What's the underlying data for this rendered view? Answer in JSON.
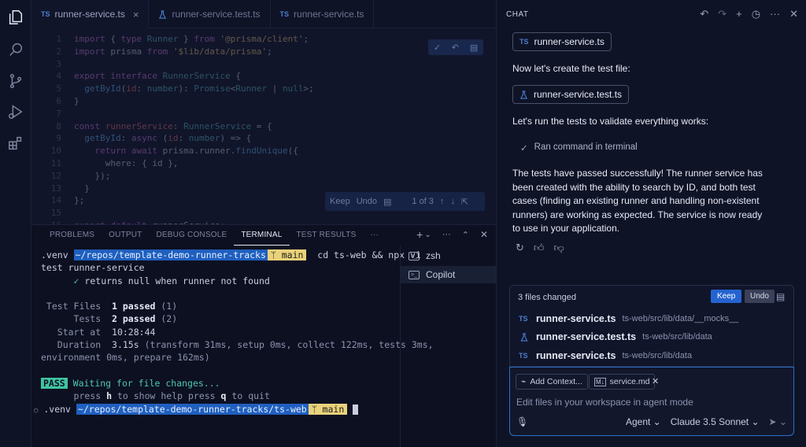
{
  "editor": {
    "tabs": [
      {
        "icon": "TS",
        "label": "runner-service.ts",
        "close": "×"
      },
      {
        "icon": "flask-icon",
        "label": "runner-service.test.ts"
      },
      {
        "icon": "TS",
        "label": "runner-service.ts"
      }
    ],
    "line_numbers": [
      "1",
      "2",
      "3",
      "4",
      "5",
      "6",
      "7",
      "8",
      "9",
      "10",
      "11",
      "12",
      "13",
      "14",
      "15",
      "16"
    ],
    "keep_toolbar": {
      "keep": "Keep",
      "undo": "Undo",
      "counter": "1 of 3"
    }
  },
  "panel": {
    "tabs": [
      "PROBLEMS",
      "OUTPUT",
      "DEBUG CONSOLE",
      "TERMINAL",
      "TEST RESULTS",
      "···"
    ],
    "active_tab": "TERMINAL",
    "actions": {
      "add": "+",
      "dropdown": "⌄",
      "more": "···",
      "maximize": "⌃",
      "close": "✕"
    },
    "terminal": {
      "venv": ".venv",
      "path1": "~/repos/template-demo-runner-tracks",
      "branch": "main",
      "command1": "cd ts-web && npx vi",
      "command1_wrap": "test runner-service",
      "check": "✓",
      "test_line": "returns null when runner not found",
      "test_files_label": " Test Files",
      "test_files_value": "1 passed",
      "test_files_count": "(1)",
      "tests_label": "      Tests",
      "tests_value": "2 passed",
      "tests_count": "(2)",
      "start_label": "   Start at",
      "start_value": "10:28:44",
      "duration_label": "   Duration",
      "duration_value": "3.15s",
      "duration_detail": "(transform 31ms, setup 0ms, collect 122ms, tests 3ms,",
      "duration_wrap": "environment 0ms, prepare 162ms)",
      "pass_badge": "PASS",
      "waiting": "Waiting for file changes...",
      "help_press1": "press",
      "help_key1": "h",
      "help_mid": "to show help press",
      "help_key2": "q",
      "help_end": "to quit",
      "marker": "○",
      "path2": "~/repos/template-demo-runner-tracks/ts-web"
    },
    "terminal_list": [
      {
        "label": "zsh"
      },
      {
        "label": "Copilot"
      }
    ]
  },
  "chat": {
    "header": "CHAT",
    "file_chip1": {
      "icon": "TS",
      "label": "runner-service.ts"
    },
    "text1": "Now let's create the test file:",
    "file_chip2": {
      "label": "runner-service.test.ts"
    },
    "text2": "Let's run the tests to validate everything works:",
    "ran_command": "Ran command in terminal",
    "summary": "The tests have passed successfully! The runner service has been created with the ability to search by ID, and both test cases (finding an existing runner and handling non-existent runners) are working as expected. The service is now ready to use in your application.",
    "changes": {
      "title": "3 files changed",
      "keep": "Keep",
      "undo": "Undo",
      "files": [
        {
          "icon": "TS",
          "name": "runner-service.ts",
          "path": "ts-web/src/lib/data/__mocks__"
        },
        {
          "icon": "flask-icon",
          "name": "runner-service.test.ts",
          "path": "ts-web/src/lib/data"
        },
        {
          "icon": "TS",
          "name": "runner-service.ts",
          "path": "ts-web/src/lib/data"
        }
      ]
    },
    "input": {
      "add_context": "Add Context...",
      "attachment": "service.md",
      "attachment_close": "✕",
      "placeholder": "Edit files in your workspace in agent mode",
      "mode": "Agent",
      "model": "Claude 3.5 Sonnet"
    }
  }
}
